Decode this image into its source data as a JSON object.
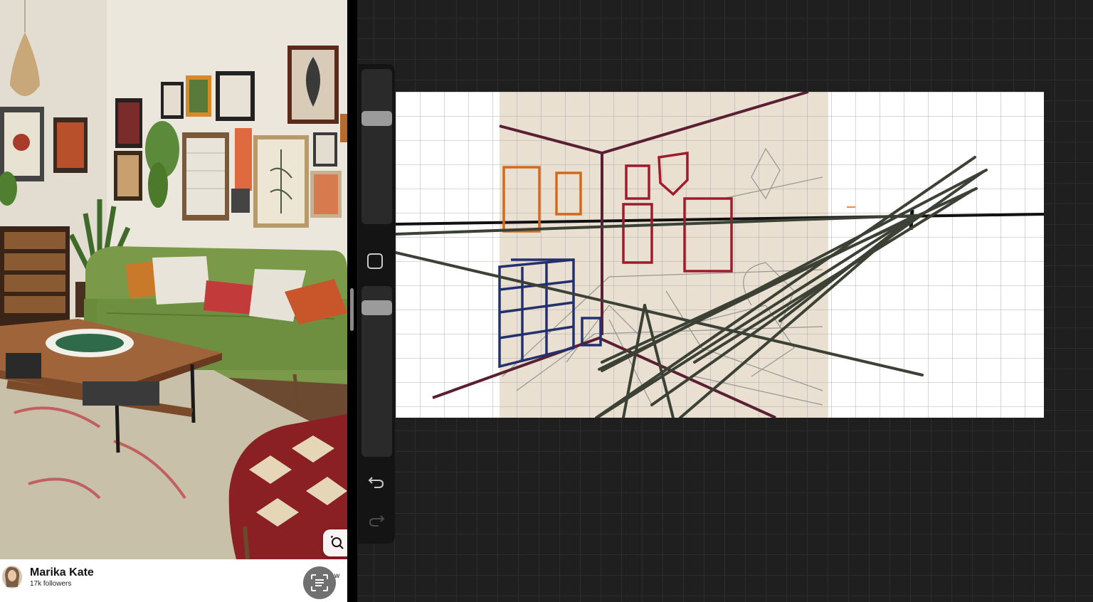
{
  "pin": {
    "author_name": "Marika Kate",
    "followers": "17k followers",
    "follow_label_partial": "w"
  },
  "icons": {
    "visual_search": "visual-search-icon",
    "lens": "lens-scan-icon",
    "modify": "square-modify-icon",
    "undo": "undo-arrow-icon",
    "redo": "redo-arrow-icon"
  },
  "drawing_app": {
    "brush_size_level": 0.3,
    "opacity_level": 0.09,
    "redo_enabled": false
  },
  "colors": {
    "canvas_bg": "#1f1f1f",
    "sofa": "#7a9a4a",
    "sketch_tan": "#e9e0d2",
    "line_black": "#111111",
    "line_dark_green": "#3c4136",
    "line_maroon": "#5a1f33",
    "line_orange": "#d26a1e",
    "line_red": "#9e1c2c",
    "line_navy": "#23306e"
  }
}
